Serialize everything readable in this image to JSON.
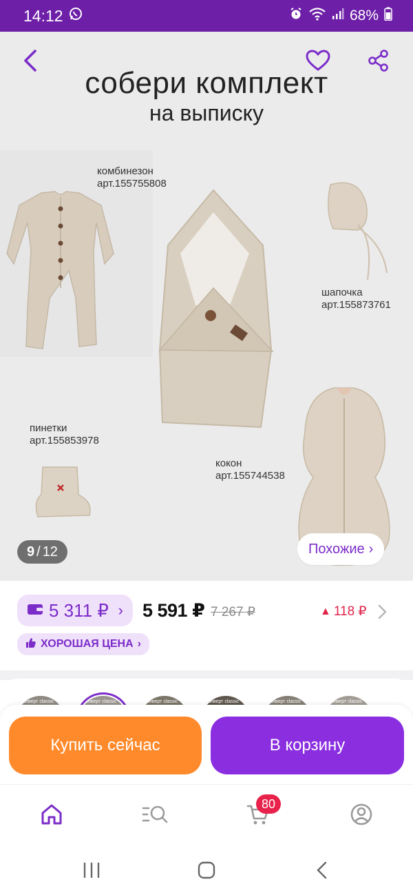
{
  "status_bar": {
    "time": "14:12",
    "battery": "68%",
    "whatsapp_icon": "whatsapp-icon",
    "alarm_icon": "alarm-icon",
    "wifi_icon": "wifi-icon",
    "signal_icon": "signal-icon"
  },
  "hero": {
    "title": "собери комплект",
    "subtitle": "на выписку",
    "products": [
      {
        "name": "комбинезон",
        "article": "арт.155755808"
      },
      {
        "name": "шапочка",
        "article": "арт.155873761"
      },
      {
        "name": "пинетки",
        "article": "арт.155853978"
      },
      {
        "name": "кокон",
        "article": "арт.155744538"
      }
    ],
    "counter": {
      "current": "9",
      "separator": "/",
      "total": "12"
    },
    "similar_label": "Похожие",
    "similar_arrow": "›"
  },
  "price": {
    "wallet_amount": "5 311 ₽",
    "wallet_arrow": "›",
    "current": "5 591 ₽",
    "old": "7 267 ₽",
    "delta": "118 ₽",
    "delta_marker": "▲",
    "good_price_label": "ХОРОШАЯ ЦЕНА",
    "good_price_arrow": "›"
  },
  "variants": {
    "labels": [
      "конверт classic",
      "конверт classic",
      "конверт classic",
      "конверт classic",
      "конверт classic",
      "конверт classic"
    ]
  },
  "actions": {
    "buy_now": "Купить сейчас",
    "add_to_cart": "В корзину"
  },
  "tabbar": {
    "cart_badge": "80"
  },
  "colors": {
    "brand_purple": "#7b2cc9",
    "status_bar": "#6d1fa8",
    "buy_orange": "#ff8a2b",
    "cart_purple": "#8a2ee0",
    "badge_red": "#e8224a",
    "delta_red": "#e0244a"
  }
}
